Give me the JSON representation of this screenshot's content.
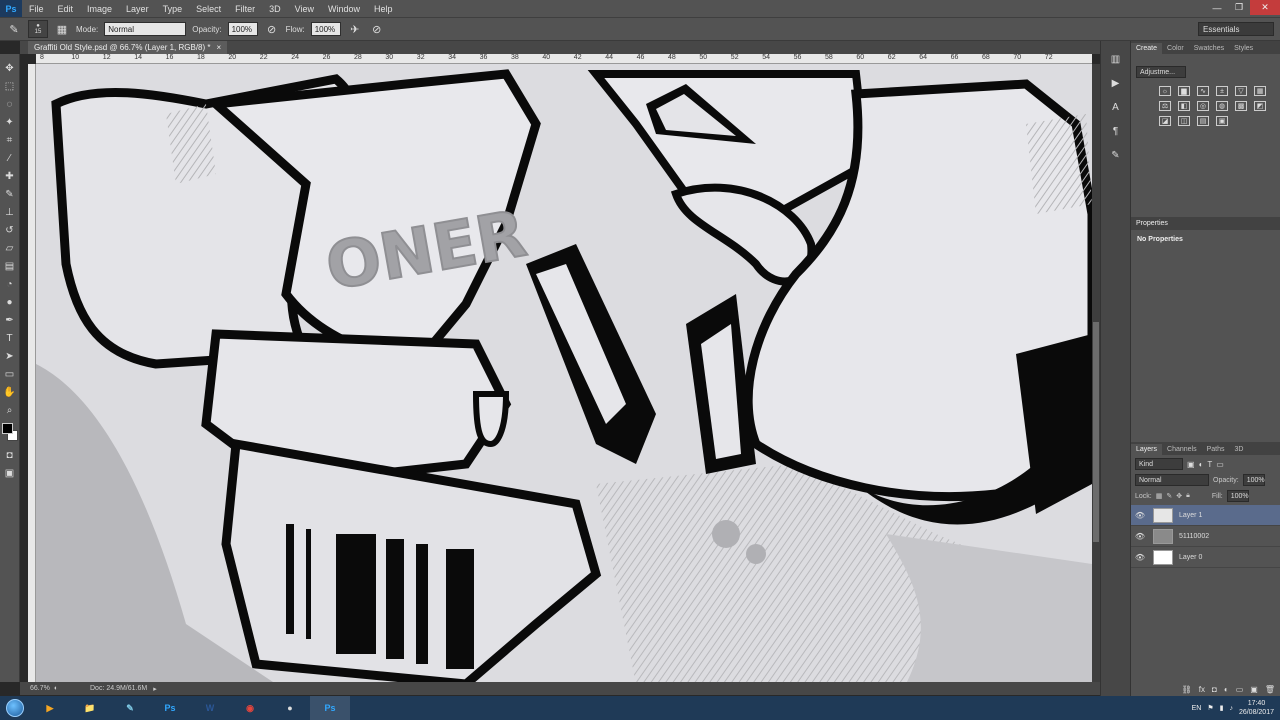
{
  "app": {
    "logo_text": "Ps",
    "menu": [
      "File",
      "Edit",
      "Image",
      "Layer",
      "Type",
      "Select",
      "Filter",
      "3D",
      "View",
      "Window",
      "Help"
    ],
    "window_controls": [
      "—",
      "❐",
      "✕"
    ]
  },
  "options_bar": {
    "brush_size": "15",
    "mode_label": "Mode:",
    "mode_value": "Normal",
    "opacity_label": "Opacity:",
    "opacity_value": "100%",
    "flow_label": "Flow:",
    "flow_value": "100%",
    "workspace": "Essentials"
  },
  "document": {
    "tab_title": "Graffiti Old Style.psd @ 66.7% (Layer 1, RGB/8) *",
    "tab_close": "×",
    "zoom": "66.7%",
    "doc_size": "Doc: 24.9M/61.6M",
    "canvas_tag": "ONER"
  },
  "ruler": {
    "ticks": [
      "8",
      "10",
      "12",
      "14",
      "16",
      "18",
      "20",
      "22",
      "24",
      "26",
      "28",
      "30",
      "32",
      "34",
      "36",
      "38",
      "40",
      "42",
      "44",
      "46",
      "48",
      "50",
      "52",
      "54",
      "56",
      "58",
      "60",
      "62",
      "64",
      "66",
      "68",
      "70",
      "72"
    ]
  },
  "panels": {
    "top_tabs": [
      "Create",
      "Color",
      "Swatches",
      "Styles"
    ],
    "adjustments_select": "Adjustme...",
    "properties_title": "Properties",
    "properties_body": "No Properties",
    "layers_tabs": [
      "Layers",
      "Channels",
      "Paths",
      "3D"
    ],
    "kind_label": "Kind",
    "blend_mode": "Normal",
    "opacity_label": "Opacity:",
    "opacity_value": "100%",
    "lock_label": "Lock:",
    "fill_label": "Fill:",
    "fill_value": "100%",
    "layers": [
      {
        "name": "Layer 1",
        "selected": true
      },
      {
        "name": "51110002",
        "selected": false
      },
      {
        "name": "Layer 0",
        "selected": false
      }
    ]
  },
  "colors": {
    "foreground": "#000000",
    "background": "#ffffff",
    "selected_layer": "#5a6b8c"
  },
  "taskbar": {
    "apps": [
      {
        "name": "media-player",
        "label": "▶",
        "color": "#f5a623"
      },
      {
        "name": "file-explorer",
        "label": "📁",
        "color": "#f0c040"
      },
      {
        "name": "drawing-app",
        "label": "✎",
        "color": "#7ec8e3"
      },
      {
        "name": "photoshop",
        "label": "Ps",
        "color": "#31a8ff"
      },
      {
        "name": "word",
        "label": "W",
        "color": "#2b5797"
      },
      {
        "name": "chrome",
        "label": "◉",
        "color": "#e8453c"
      },
      {
        "name": "obs",
        "label": "●",
        "color": "#dddddd"
      },
      {
        "name": "photoshop-active",
        "label": "Ps",
        "color": "#31a8ff"
      }
    ],
    "lang": "EN",
    "time": "17:40",
    "date": "26/08/2017"
  }
}
